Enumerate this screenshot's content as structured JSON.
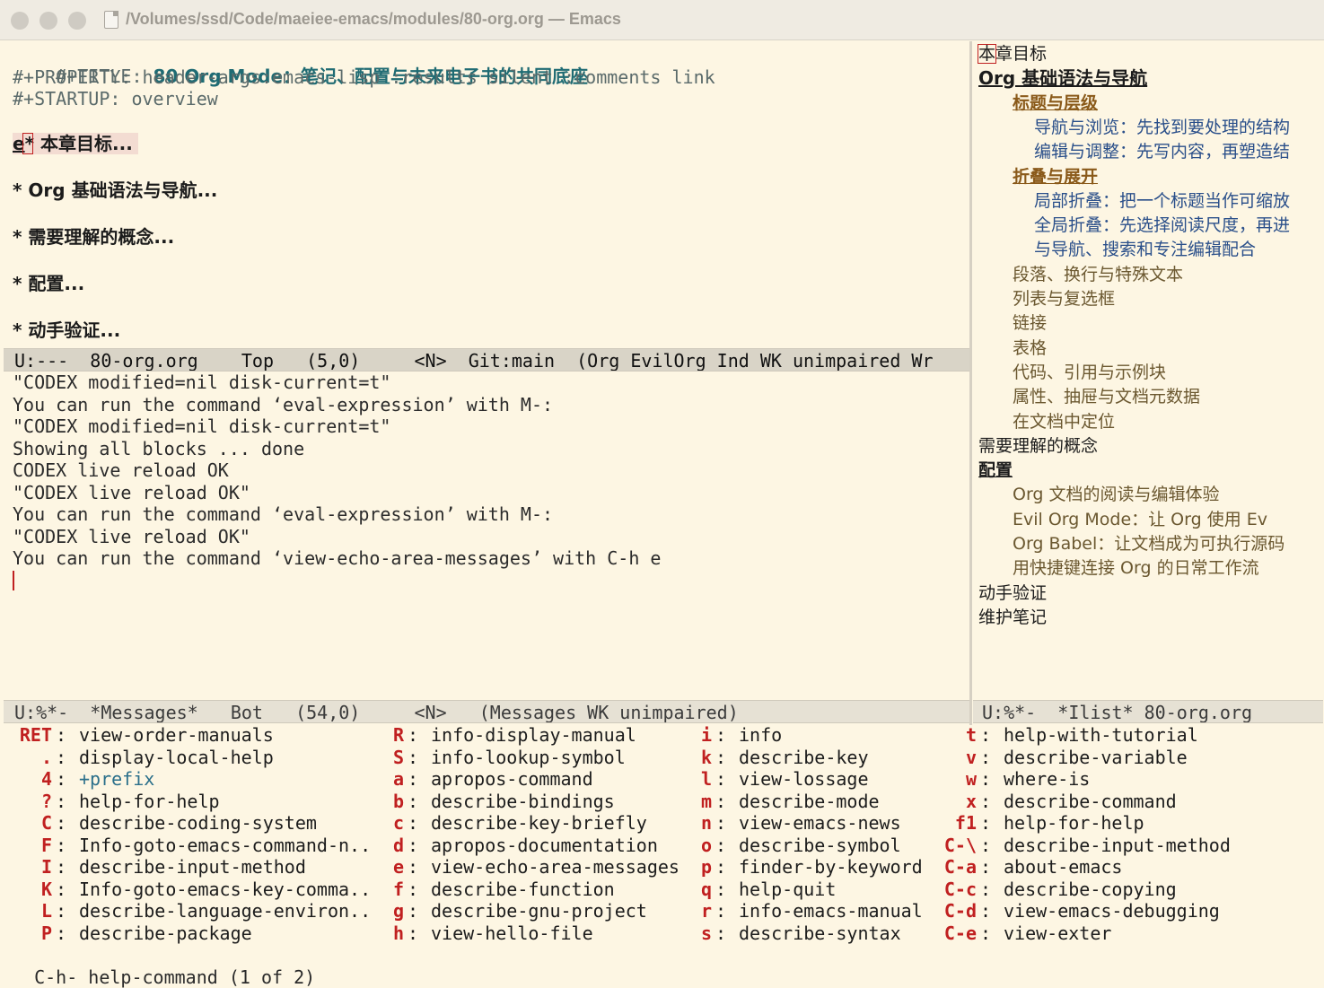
{
  "window": {
    "title": "/Volumes/ssd/Code/maeiee-emacs/modules/80-org.org — Emacs"
  },
  "org_buffer": {
    "title_kw": "#+TITLE: ",
    "title_val": "80 Org Mode：笔记、配置与未来电子书的共同底座",
    "property_line": "#+PROPERTY: header-args:emacs-lisp :results silent :comments link",
    "startup_line": "#+STARTUP: overview",
    "cursor_char": "e",
    "headings": [
      "* 本章目标...",
      "* Org 基础语法与导航...",
      "* 需要理解的概念...",
      "* 配置...",
      "* 动手验证..."
    ]
  },
  "org_modeline": "U:---  80-org.org    Top   (5,0)     <N>  Git:main  (Org EvilOrg Ind WK unimpaired Wr",
  "messages": [
    "\"CODEX modified=nil disk-current=t\"",
    "You can run the command ‘eval-expression’ with M-:",
    "\"CODEX modified=nil disk-current=t\"",
    "Showing all blocks ... done",
    "CODEX live reload OK",
    "\"CODEX live reload OK\"",
    "You can run the command ‘eval-expression’ with M-:",
    "\"CODEX live reload OK\"",
    "You can run the command ‘view-echo-area-messages’ with C-h e"
  ],
  "messages_modeline": "U:%*-  *Messages*   Bot   (54,0)     <N>   (Messages WK unimpaired)",
  "ilist": {
    "items": [
      "本章目标",
      "Org 基础语法与导航",
      "标题与层级",
      "导航与浏览：先找到要处理的结构",
      "编辑与调整：先写内容，再塑造结",
      "折叠与展开",
      "局部折叠：把一个标题当作可缩放",
      "全局折叠：先选择阅读尺度，再进",
      "与导航、搜索和专注编辑配合",
      "段落、换行与特殊文本",
      "列表与复选框",
      "链接",
      "表格",
      "代码、引用与示例块",
      "属性、抽屉与文档元数据",
      "在文档中定位",
      "需要理解的概念",
      "配置",
      "Org 文档的阅读与编辑体验",
      "Evil Org Mode：让 Org 使用 Ev",
      "Org Babel：让文档成为可执行源码",
      "用快捷键连接 Org 的日常工作流",
      "动手验证",
      "维护笔记"
    ],
    "modeline": "U:%*-  *Ilist* 80-org.org"
  },
  "which_key": {
    "columns": [
      [
        [
          "RET",
          "view-order-manuals"
        ],
        [
          ".",
          "display-local-help"
        ],
        [
          "4",
          "+prefix"
        ],
        [
          "?",
          "help-for-help"
        ],
        [
          "C",
          "describe-coding-system"
        ],
        [
          "F",
          "Info-goto-emacs-command-n.."
        ],
        [
          "I",
          "describe-input-method"
        ],
        [
          "K",
          "Info-goto-emacs-key-comma.."
        ],
        [
          "L",
          "describe-language-environ.."
        ],
        [
          "P",
          "describe-package"
        ]
      ],
      [
        [
          "R",
          "info-display-manual"
        ],
        [
          "S",
          "info-lookup-symbol"
        ],
        [
          "a",
          "apropos-command"
        ],
        [
          "b",
          "describe-bindings"
        ],
        [
          "c",
          "describe-key-briefly"
        ],
        [
          "d",
          "apropos-documentation"
        ],
        [
          "e",
          "view-echo-area-messages"
        ],
        [
          "f",
          "describe-function"
        ],
        [
          "g",
          "describe-gnu-project"
        ],
        [
          "h",
          "view-hello-file"
        ]
      ],
      [
        [
          "i",
          "info"
        ],
        [
          "k",
          "describe-key"
        ],
        [
          "l",
          "view-lossage"
        ],
        [
          "m",
          "describe-mode"
        ],
        [
          "n",
          "view-emacs-news"
        ],
        [
          "o",
          "describe-symbol"
        ],
        [
          "p",
          "finder-by-keyword"
        ],
        [
          "q",
          "help-quit"
        ],
        [
          "r",
          "info-emacs-manual"
        ],
        [
          "s",
          "describe-syntax"
        ]
      ],
      [
        [
          "t",
          "help-with-tutorial"
        ],
        [
          "v",
          "describe-variable"
        ],
        [
          "w",
          "where-is"
        ],
        [
          "x",
          "describe-command"
        ],
        [
          "f1",
          "help-for-help"
        ],
        [
          "C-\\",
          "describe-input-method"
        ],
        [
          "C-a",
          "about-emacs"
        ],
        [
          "C-c",
          "describe-copying"
        ],
        [
          "C-d",
          "view-emacs-debugging"
        ],
        [
          "C-e",
          "view-exter"
        ]
      ]
    ],
    "footer": "C-h- help-command (1 of 2)"
  }
}
